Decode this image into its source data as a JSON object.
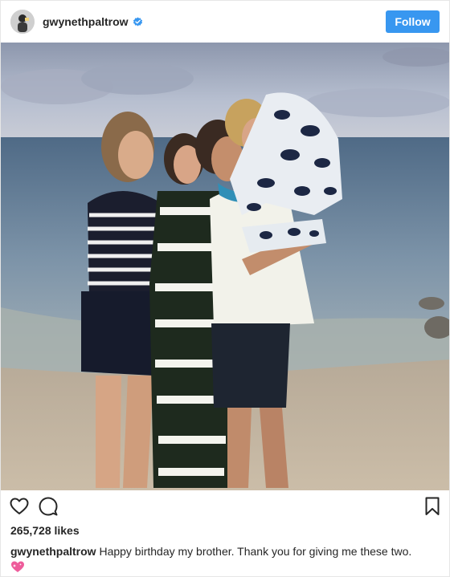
{
  "header": {
    "username": "gwynethpaltrow",
    "verified_icon": "verified-badge-icon",
    "follow_label": "Follow",
    "accent_color": "#3897f0"
  },
  "photo": {
    "icon": "beach-family-photo"
  },
  "actions": {
    "like_icon": "heart-icon",
    "comment_icon": "comment-icon",
    "save_icon": "bookmark-icon"
  },
  "likes": {
    "text": "265,728 likes"
  },
  "caption": {
    "username": "gwynethpaltrow",
    "text": "Happy birthday my brother. Thank you for giving me these two.",
    "emoji_icon": "sparkling-heart-icon"
  }
}
